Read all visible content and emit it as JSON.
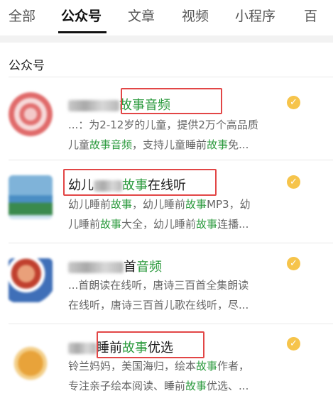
{
  "tabs": [
    "全部",
    "公众号",
    "文章",
    "视频",
    "小程序",
    "百"
  ],
  "section_title": "公众号",
  "results": [
    {
      "name_suffix": "故事音频",
      "desc_line1": "...：为2-12岁的儿童，提供2万个高品质",
      "desc_line2_a": "儿童",
      "desc_line2_b": "故事",
      "desc_line2_c": "音频",
      "desc_line2_d": "，支持儿童睡前",
      "desc_line2_e": "故事",
      "desc_line2_f": "免..."
    },
    {
      "name_a": "幼儿",
      "name_b": "故事",
      "name_c": "在线听",
      "desc_line1_a": "幼儿睡前",
      "desc_line1_b": "故事",
      "desc_line1_c": "，幼儿睡前",
      "desc_line1_d": "故事",
      "desc_line1_e": "MP3，幼",
      "desc_line2_a": "儿睡前",
      "desc_line2_b": "故事",
      "desc_line2_c": "大全，幼儿睡前",
      "desc_line2_d": "故事",
      "desc_line2_e": "连播..."
    },
    {
      "name_a": "首",
      "name_b": "音频",
      "desc_line1": "...首朗读在线听，唐诗三百首全集朗读",
      "desc_line2": "在线听，唐诗三百首儿歌在线听，尽..."
    },
    {
      "name_a": "睡前",
      "name_b": "故事",
      "name_c": "优选",
      "desc_line1_a": "铃兰妈妈，美国海归，绘本",
      "desc_line1_b": "故事",
      "desc_line1_c": "作者，",
      "desc_line2_a": "专注亲子绘本阅读、睡前",
      "desc_line2_b": "故事",
      "desc_line2_c": "优选、..."
    }
  ],
  "icons": {
    "verified": "verified-badge-icon",
    "avatar": "account-avatar"
  },
  "colors": {
    "highlight": "#2b9a3d",
    "redbox": "#e24646",
    "badge": "#f6c44b"
  }
}
